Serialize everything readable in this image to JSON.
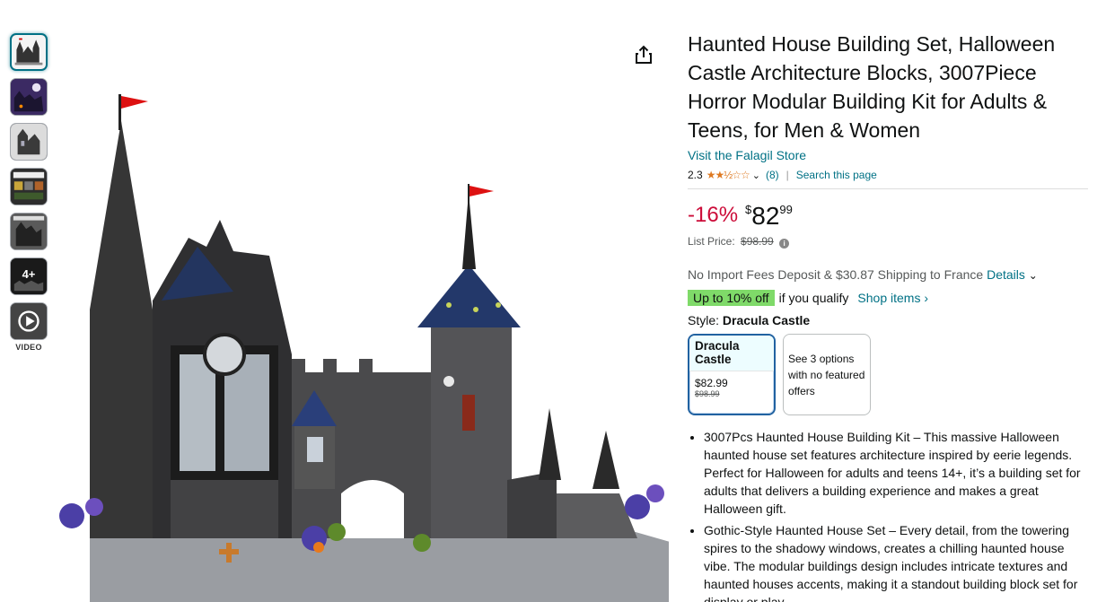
{
  "thumbnails": [
    {
      "name": "thumb-main"
    },
    {
      "name": "thumb-night"
    },
    {
      "name": "thumb-detail"
    },
    {
      "name": "thumb-info"
    },
    {
      "name": "thumb-dracula"
    },
    {
      "name": "thumb-age",
      "badge": "4+"
    },
    {
      "name": "thumb-video"
    }
  ],
  "video_label": "VIDEO",
  "product": {
    "title": "Haunted House Building Set, Halloween Castle Architecture Blocks, 3007Piece Horror Modular Building Kit for Adults & Teens, for Men & Women",
    "store_link": "Visit the Falagil Store",
    "rating": "2.3",
    "stars": "★★½☆☆",
    "review_count": "(8)",
    "search_page": "Search this page"
  },
  "price": {
    "discount": "-16%",
    "currency": "$",
    "whole": "82",
    "fraction": "99",
    "list_label": "List Price:",
    "list_value": "$98.99"
  },
  "shipping": {
    "text": "No Import Fees Deposit & $30.87 Shipping to France",
    "details_link": "Details"
  },
  "deal": {
    "badge": "Up to 10% off",
    "qualifier": "if you qualify",
    "shop_link": "Shop items ›"
  },
  "style": {
    "label": "Style:",
    "selected": "Dracula Castle",
    "options": [
      {
        "name": "Dracula Castle",
        "price": "$82.99",
        "list": "$98.99"
      },
      {
        "text": "See 3 options with no featured offers"
      }
    ]
  },
  "bullets": [
    "3007Pcs Haunted House Building Kit – This massive Halloween haunted house set features architecture inspired by eerie legends. Perfect for Halloween for adults and teens 14+, it’s a building set for adults that delivers a building experience and makes a great Halloween gift.",
    "Gothic-Style Haunted House Set – Every detail, from the towering spires to the shadowy windows, creates a chilling haunted house vibe. The modular buildings design includes intricate textures and haunted houses accents, making it a standout building block set for display or play."
  ],
  "colors": {
    "link": "#007185",
    "discount": "#cc0c39",
    "star": "#de7921",
    "deal_badge": "#7fda69",
    "selected_border": "#2162a1"
  }
}
